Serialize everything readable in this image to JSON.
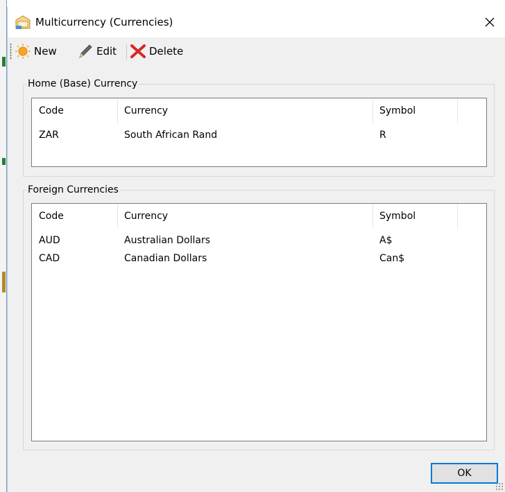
{
  "window": {
    "title": "Multicurrency (Currencies)",
    "close_glyph": "✕",
    "icons": {
      "app": "currency-window-icon",
      "close": "close-icon"
    }
  },
  "toolbar": {
    "new_label": "New",
    "edit_label": "Edit",
    "delete_label": "Delete",
    "icons": {
      "new": "new-sun-icon",
      "edit": "pencil-icon",
      "delete": "red-x-icon"
    }
  },
  "home_currency": {
    "legend": "Home (Base) Currency",
    "columns": [
      "Code",
      "Currency",
      "Symbol"
    ],
    "rows": [
      {
        "code": "ZAR",
        "currency": "South African Rand",
        "symbol": "R"
      }
    ]
  },
  "foreign_currencies": {
    "legend": "Foreign Currencies",
    "columns": [
      "Code",
      "Currency",
      "Symbol"
    ],
    "rows": [
      {
        "code": "AUD",
        "currency": "Australian Dollars",
        "symbol": "A$"
      },
      {
        "code": "CAD",
        "currency": "Canadian Dollars",
        "symbol": "Can$"
      }
    ]
  },
  "footer": {
    "ok_label": "OK"
  },
  "colors": {
    "accent": "#0078d7",
    "delete": "#d62828",
    "new": "#f5a623"
  }
}
